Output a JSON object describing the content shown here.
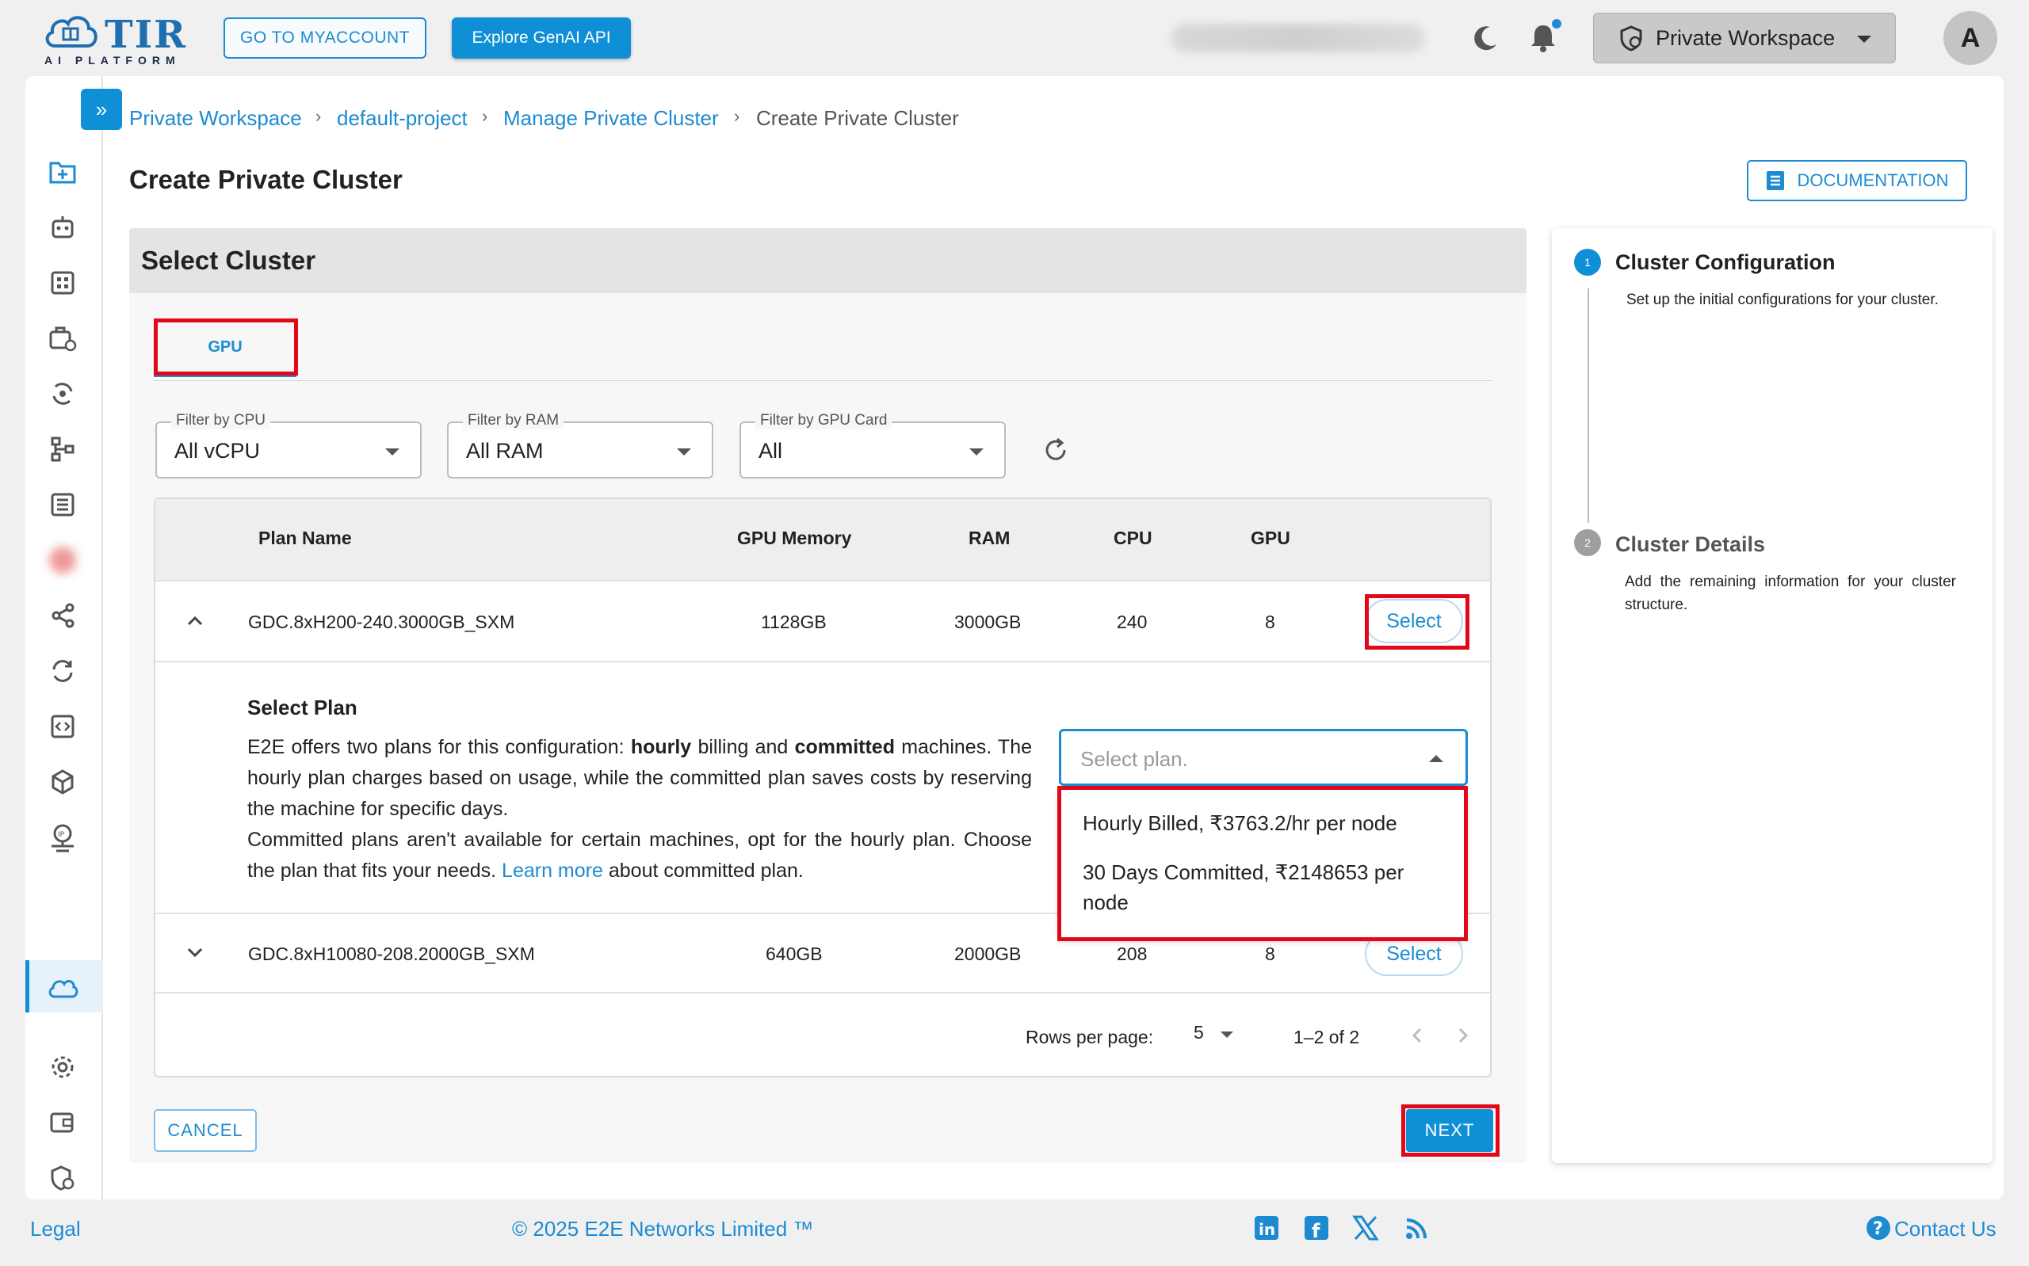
{
  "header": {
    "logo_text": "TIR",
    "logo_sub": "AI PLATFORM",
    "myaccount_label": "GO TO MYACCOUNT",
    "genai_label": "Explore GenAI API",
    "workspace_label": "Private Workspace",
    "avatar_letter": "A"
  },
  "breadcrumb": [
    "Private Workspace",
    "default-project",
    "Manage Private Cluster",
    "Create Private Cluster"
  ],
  "page_title": "Create Private Cluster",
  "documentation_label": "DOCUMENTATION",
  "card": {
    "title": "Select Cluster",
    "tab_label": "GPU",
    "filters": [
      {
        "label": "Filter by CPU",
        "value": "All vCPU"
      },
      {
        "label": "Filter by RAM",
        "value": "All RAM"
      },
      {
        "label": "Filter by GPU Card",
        "value": "All"
      }
    ],
    "table": {
      "columns": [
        "Plan Name",
        "GPU Memory",
        "RAM",
        "CPU",
        "GPU"
      ],
      "rows": [
        {
          "plan": "GDC.8xH200-240.3000GB_SXM",
          "gpu_memory": "1128GB",
          "ram": "3000GB",
          "cpu": "240",
          "gpu": "8",
          "action": "Select"
        },
        {
          "plan": "GDC.8xH10080-208.2000GB_SXM",
          "gpu_memory": "640GB",
          "ram": "2000GB",
          "cpu": "208",
          "gpu": "8",
          "action": "Select"
        }
      ]
    },
    "select_plan": {
      "title": "Select Plan",
      "text_1": "E2E offers two plans for this configuration: ",
      "bold_1": "hourly",
      "text_2": " billing and ",
      "bold_2": "committed",
      "text_3": " machines. The hourly plan charges based on usage, while the committed plan saves costs by reserving the machine for specific days.",
      "text_4": "Committed plans aren't available for certain machines, opt for the hourly plan. Choose the plan that fits your needs. ",
      "link": "Learn more",
      "text_5": " about committed plan.",
      "placeholder": "Select plan.",
      "options": [
        "Hourly Billed, ₹3763.2/hr per node",
        "30 Days Committed, ₹2148653 per node"
      ]
    },
    "pagination": {
      "rows_label": "Rows per page:",
      "rows_value": "5",
      "range": "1–2 of 2"
    },
    "cancel_label": "CANCEL",
    "next_label": "NEXT"
  },
  "stepper": [
    {
      "num": "1",
      "title": "Cluster Configuration",
      "desc": "Set up the initial configurations for your cluster."
    },
    {
      "num": "2",
      "title": "Cluster Details",
      "desc": "Add the remaining information for your cluster structure."
    }
  ],
  "footer": {
    "legal": "Legal",
    "copyright": "© 2025 E2E Networks Limited ™",
    "contact": "Contact Us"
  },
  "colors": {
    "accent": "#0e8fd6",
    "highlight": "#e1081a",
    "notification_dot": "#1d8bd1"
  },
  "icons": [
    "cloud-logo-icon",
    "moon-icon",
    "bell-icon",
    "workspace-icon",
    "chevron-double-right-icon",
    "refresh-icon",
    "chevron-up-icon",
    "chevron-down-icon",
    "document-icon",
    "linkedin-icon",
    "facebook-icon",
    "x-icon",
    "rss-icon",
    "help-icon"
  ]
}
